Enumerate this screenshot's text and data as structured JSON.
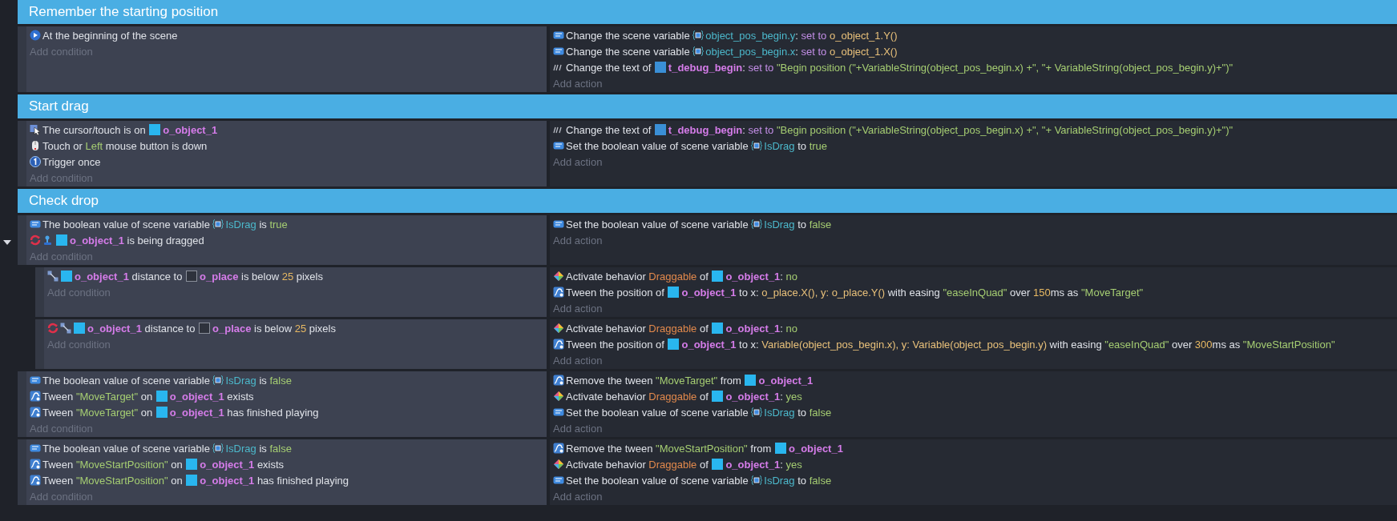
{
  "groups": [
    {
      "title": "Remember the starting position",
      "events": [
        {
          "conditions": [
            {
              "kind": "start",
              "inverted": false,
              "parts": [
                {
                  "kind": "text",
                  "text": "At the beginning of the scene"
                }
              ]
            }
          ],
          "add_condition": "Add condition",
          "actions": [
            {
              "kind": "var",
              "parts": [
                {
                  "kind": "text",
                  "text": "Change the scene variable "
                },
                {
                  "kind": "variable",
                  "text": "object_pos_begin.y"
                },
                {
                  "kind": "text",
                  "text": ": "
                },
                {
                  "kind": "keyword",
                  "text": "set to "
                },
                {
                  "kind": "expression",
                  "text": "o_object_1.Y()"
                }
              ]
            },
            {
              "kind": "var",
              "parts": [
                {
                  "kind": "text",
                  "text": "Change the scene variable "
                },
                {
                  "kind": "variable",
                  "text": "object_pos_begin.x"
                },
                {
                  "kind": "text",
                  "text": ": "
                },
                {
                  "kind": "keyword",
                  "text": "set to "
                },
                {
                  "kind": "expression",
                  "text": "o_object_1.X()"
                }
              ]
            },
            {
              "kind": "text",
              "parts": [
                {
                  "kind": "text",
                  "text": "Change the text of "
                },
                {
                  "kind": "object",
                  "text": "t_debug_begin",
                  "color": "#3a8fd6"
                },
                {
                  "kind": "text",
                  "text": ": "
                },
                {
                  "kind": "keyword",
                  "text": "set to "
                },
                {
                  "kind": "value",
                  "text": "\"Begin position (\"+VariableString(object_pos_begin.x) +\", \"+ VariableString(object_pos_begin.y)+\")\""
                }
              ]
            }
          ],
          "add_action": "Add action"
        }
      ]
    },
    {
      "title": "Start drag",
      "events": [
        {
          "conditions": [
            {
              "kind": "cursor",
              "inverted": false,
              "parts": [
                {
                  "kind": "text",
                  "text": "The cursor/touch is on "
                },
                {
                  "kind": "object",
                  "text": "o_object_1",
                  "color": "#29b6ef"
                }
              ]
            },
            {
              "kind": "mouse",
              "inverted": false,
              "parts": [
                {
                  "kind": "text",
                  "text": "Touch or "
                },
                {
                  "kind": "value",
                  "text": "Left"
                },
                {
                  "kind": "text",
                  "text": " mouse button is down"
                }
              ]
            },
            {
              "kind": "once",
              "inverted": false,
              "parts": [
                {
                  "kind": "text",
                  "text": "Trigger once"
                }
              ]
            }
          ],
          "add_condition": "Add condition",
          "actions": [
            {
              "kind": "text",
              "parts": [
                {
                  "kind": "text",
                  "text": "Change the text of "
                },
                {
                  "kind": "object",
                  "text": "t_debug_begin",
                  "color": "#3a8fd6"
                },
                {
                  "kind": "text",
                  "text": ": "
                },
                {
                  "kind": "keyword",
                  "text": "set to "
                },
                {
                  "kind": "value",
                  "text": "\"Begin position (\"+VariableString(object_pos_begin.x) +\", \"+ VariableString(object_pos_begin.y)+\")\""
                }
              ]
            },
            {
              "kind": "var",
              "parts": [
                {
                  "kind": "text",
                  "text": "Set the boolean value of scene variable "
                },
                {
                  "kind": "variable",
                  "text": "IsDrag"
                },
                {
                  "kind": "text",
                  "text": " to "
                },
                {
                  "kind": "value",
                  "text": "true"
                }
              ]
            }
          ],
          "add_action": "Add action"
        }
      ]
    },
    {
      "title": "Check drop",
      "events": [
        {
          "expanded": true,
          "conditions": [
            {
              "kind": "var",
              "inverted": false,
              "parts": [
                {
                  "kind": "text",
                  "text": "The boolean value of scene variable "
                },
                {
                  "kind": "variable",
                  "text": "IsDrag"
                },
                {
                  "kind": "text",
                  "text": " is "
                },
                {
                  "kind": "value",
                  "text": "true"
                }
              ]
            },
            {
              "kind": "drag",
              "inverted": true,
              "parts": [
                {
                  "kind": "object",
                  "text": "o_object_1",
                  "color": "#29b6ef"
                },
                {
                  "kind": "text",
                  "text": " is being dragged"
                }
              ]
            }
          ],
          "add_condition": "Add condition",
          "actions": [
            {
              "kind": "var",
              "parts": [
                {
                  "kind": "text",
                  "text": "Set the boolean value of scene variable "
                },
                {
                  "kind": "variable",
                  "text": "IsDrag"
                },
                {
                  "kind": "text",
                  "text": " to "
                },
                {
                  "kind": "value",
                  "text": "false"
                }
              ]
            }
          ],
          "add_action": "Add action",
          "children": [
            {
              "conditions": [
                {
                  "kind": "distance",
                  "inverted": false,
                  "parts": [
                    {
                      "kind": "object",
                      "text": "o_object_1",
                      "color": "#29b6ef"
                    },
                    {
                      "kind": "text",
                      "text": " distance to "
                    },
                    {
                      "kind": "object",
                      "text": "o_place",
                      "color": "#2e323c"
                    },
                    {
                      "kind": "text",
                      "text": " is below "
                    },
                    {
                      "kind": "number",
                      "text": "25"
                    },
                    {
                      "kind": "text",
                      "text": " pixels"
                    }
                  ]
                }
              ],
              "add_condition": "Add condition",
              "actions": [
                {
                  "kind": "behavior",
                  "parts": [
                    {
                      "kind": "text",
                      "text": "Activate behavior "
                    },
                    {
                      "kind": "behavior",
                      "text": "Draggable"
                    },
                    {
                      "kind": "text",
                      "text": " of "
                    },
                    {
                      "kind": "object",
                      "text": "o_object_1",
                      "color": "#29b6ef"
                    },
                    {
                      "kind": "text",
                      "text": ": "
                    },
                    {
                      "kind": "value",
                      "text": "no"
                    }
                  ]
                },
                {
                  "kind": "tween",
                  "parts": [
                    {
                      "kind": "text",
                      "text": "Tween the position of "
                    },
                    {
                      "kind": "object",
                      "text": "o_object_1",
                      "color": "#29b6ef"
                    },
                    {
                      "kind": "text",
                      "text": " to x: "
                    },
                    {
                      "kind": "expression",
                      "text": "o_place.X(), y: o_place.Y()"
                    },
                    {
                      "kind": "text",
                      "text": " with easing "
                    },
                    {
                      "kind": "value",
                      "text": "\"easeInQuad\""
                    },
                    {
                      "kind": "text",
                      "text": " over "
                    },
                    {
                      "kind": "number",
                      "text": "150"
                    },
                    {
                      "kind": "text",
                      "text": "ms as "
                    },
                    {
                      "kind": "value",
                      "text": "\"MoveTarget\""
                    }
                  ]
                }
              ],
              "add_action": "Add action"
            },
            {
              "conditions": [
                {
                  "kind": "distance",
                  "inverted": true,
                  "parts": [
                    {
                      "kind": "object",
                      "text": "o_object_1",
                      "color": "#29b6ef"
                    },
                    {
                      "kind": "text",
                      "text": " distance to "
                    },
                    {
                      "kind": "object",
                      "text": "o_place",
                      "color": "#2e323c"
                    },
                    {
                      "kind": "text",
                      "text": " is below "
                    },
                    {
                      "kind": "number",
                      "text": "25"
                    },
                    {
                      "kind": "text",
                      "text": " pixels"
                    }
                  ]
                }
              ],
              "add_condition": "Add condition",
              "actions": [
                {
                  "kind": "behavior",
                  "parts": [
                    {
                      "kind": "text",
                      "text": "Activate behavior "
                    },
                    {
                      "kind": "behavior",
                      "text": "Draggable"
                    },
                    {
                      "kind": "text",
                      "text": " of "
                    },
                    {
                      "kind": "object",
                      "text": "o_object_1",
                      "color": "#29b6ef"
                    },
                    {
                      "kind": "text",
                      "text": ": "
                    },
                    {
                      "kind": "value",
                      "text": "no"
                    }
                  ]
                },
                {
                  "kind": "tween",
                  "parts": [
                    {
                      "kind": "text",
                      "text": "Tween the position of "
                    },
                    {
                      "kind": "object",
                      "text": "o_object_1",
                      "color": "#29b6ef"
                    },
                    {
                      "kind": "text",
                      "text": " to x: "
                    },
                    {
                      "kind": "expression",
                      "text": "Variable(object_pos_begin.x), y: Variable(object_pos_begin.y)"
                    },
                    {
                      "kind": "text",
                      "text": " with easing "
                    },
                    {
                      "kind": "value",
                      "text": "\"easeInQuad\""
                    },
                    {
                      "kind": "text",
                      "text": " over "
                    },
                    {
                      "kind": "number",
                      "text": "300"
                    },
                    {
                      "kind": "text",
                      "text": "ms as "
                    },
                    {
                      "kind": "value",
                      "text": "\"MoveStartPosition\""
                    }
                  ]
                }
              ],
              "add_action": "Add action"
            }
          ]
        },
        {
          "conditions": [
            {
              "kind": "var",
              "inverted": false,
              "parts": [
                {
                  "kind": "text",
                  "text": "The boolean value of scene variable "
                },
                {
                  "kind": "variable",
                  "text": "IsDrag"
                },
                {
                  "kind": "text",
                  "text": " is "
                },
                {
                  "kind": "value",
                  "text": "false"
                }
              ]
            },
            {
              "kind": "tween",
              "inverted": false,
              "parts": [
                {
                  "kind": "text",
                  "text": "Tween "
                },
                {
                  "kind": "value",
                  "text": "\"MoveTarget\""
                },
                {
                  "kind": "text",
                  "text": " on "
                },
                {
                  "kind": "object",
                  "text": "o_object_1",
                  "color": "#29b6ef"
                },
                {
                  "kind": "text",
                  "text": " exists"
                }
              ]
            },
            {
              "kind": "tween",
              "inverted": false,
              "parts": [
                {
                  "kind": "text",
                  "text": "Tween "
                },
                {
                  "kind": "value",
                  "text": "\"MoveTarget\""
                },
                {
                  "kind": "text",
                  "text": " on "
                },
                {
                  "kind": "object",
                  "text": "o_object_1",
                  "color": "#29b6ef"
                },
                {
                  "kind": "text",
                  "text": " has finished playing"
                }
              ]
            }
          ],
          "add_condition": "Add condition",
          "actions": [
            {
              "kind": "tween",
              "parts": [
                {
                  "kind": "text",
                  "text": "Remove the tween "
                },
                {
                  "kind": "value",
                  "text": "\"MoveTarget\""
                },
                {
                  "kind": "text",
                  "text": " from "
                },
                {
                  "kind": "object",
                  "text": "o_object_1",
                  "color": "#29b6ef"
                }
              ]
            },
            {
              "kind": "behavior",
              "parts": [
                {
                  "kind": "text",
                  "text": "Activate behavior "
                },
                {
                  "kind": "behavior",
                  "text": "Draggable"
                },
                {
                  "kind": "text",
                  "text": " of "
                },
                {
                  "kind": "object",
                  "text": "o_object_1",
                  "color": "#29b6ef"
                },
                {
                  "kind": "text",
                  "text": ": "
                },
                {
                  "kind": "value",
                  "text": "yes"
                }
              ]
            },
            {
              "kind": "var",
              "parts": [
                {
                  "kind": "text",
                  "text": "Set the boolean value of scene variable "
                },
                {
                  "kind": "variable",
                  "text": "IsDrag"
                },
                {
                  "kind": "text",
                  "text": " to "
                },
                {
                  "kind": "value",
                  "text": "false"
                }
              ]
            }
          ],
          "add_action": "Add action"
        },
        {
          "conditions": [
            {
              "kind": "var",
              "inverted": false,
              "parts": [
                {
                  "kind": "text",
                  "text": "The boolean value of scene variable "
                },
                {
                  "kind": "variable",
                  "text": "IsDrag"
                },
                {
                  "kind": "text",
                  "text": " is "
                },
                {
                  "kind": "value",
                  "text": "false"
                }
              ]
            },
            {
              "kind": "tween",
              "inverted": false,
              "parts": [
                {
                  "kind": "text",
                  "text": "Tween "
                },
                {
                  "kind": "value",
                  "text": "\"MoveStartPosition\""
                },
                {
                  "kind": "text",
                  "text": " on "
                },
                {
                  "kind": "object",
                  "text": "o_object_1",
                  "color": "#29b6ef"
                },
                {
                  "kind": "text",
                  "text": " exists"
                }
              ]
            },
            {
              "kind": "tween",
              "inverted": false,
              "parts": [
                {
                  "kind": "text",
                  "text": "Tween "
                },
                {
                  "kind": "value",
                  "text": "\"MoveStartPosition\""
                },
                {
                  "kind": "text",
                  "text": " on "
                },
                {
                  "kind": "object",
                  "text": "o_object_1",
                  "color": "#29b6ef"
                },
                {
                  "kind": "text",
                  "text": " has finished playing"
                }
              ]
            }
          ],
          "add_condition": "Add condition",
          "actions": [
            {
              "kind": "tween",
              "parts": [
                {
                  "kind": "text",
                  "text": "Remove the tween "
                },
                {
                  "kind": "value",
                  "text": "\"MoveStartPosition\""
                },
                {
                  "kind": "text",
                  "text": " from "
                },
                {
                  "kind": "object",
                  "text": "o_object_1",
                  "color": "#29b6ef"
                }
              ]
            },
            {
              "kind": "behavior",
              "parts": [
                {
                  "kind": "text",
                  "text": "Activate behavior "
                },
                {
                  "kind": "behavior",
                  "text": "Draggable"
                },
                {
                  "kind": "text",
                  "text": " of "
                },
                {
                  "kind": "object",
                  "text": "o_object_1",
                  "color": "#29b6ef"
                },
                {
                  "kind": "text",
                  "text": ": "
                },
                {
                  "kind": "value",
                  "text": "yes"
                }
              ]
            },
            {
              "kind": "var",
              "parts": [
                {
                  "kind": "text",
                  "text": "Set the boolean value of scene variable "
                },
                {
                  "kind": "variable",
                  "text": "IsDrag"
                },
                {
                  "kind": "text",
                  "text": " to "
                },
                {
                  "kind": "value",
                  "text": "false"
                }
              ]
            }
          ],
          "add_action": "Add action"
        }
      ]
    }
  ]
}
